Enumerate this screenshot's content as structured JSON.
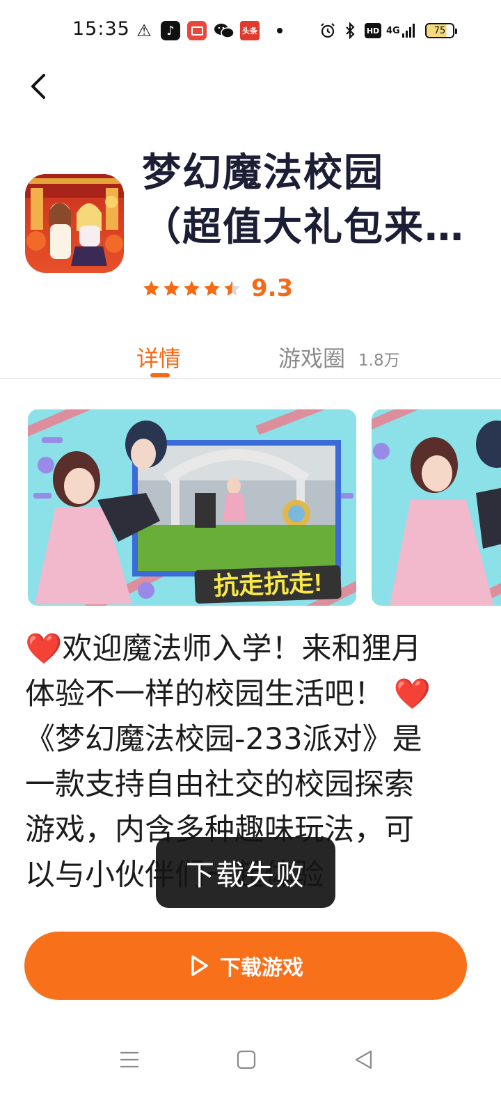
{
  "status_bar": {
    "time": "15:35",
    "battery": "75",
    "network": "4G",
    "hd_badge": "HD",
    "toutiao_badge": "头条",
    "icons": [
      "warning-icon",
      "tiktok-icon",
      "video-icon",
      "wechat-icon",
      "toutiao-icon",
      "alarm-icon",
      "bluetooth-icon",
      "hd-icon",
      "signal-icon",
      "battery-icon"
    ]
  },
  "header": {
    "back_icon": "chevron-left-icon",
    "title_line1": "梦幻魔法校园",
    "title_line2": "（超值大礼包来…",
    "rating": 4.5,
    "rating_score": "9.3"
  },
  "tabs": [
    {
      "label": "详情",
      "active": true
    },
    {
      "label": "游戏圈",
      "count": "1.8万",
      "active": false
    }
  ],
  "screenshots": {
    "caption": "抗走抗走!"
  },
  "description": {
    "heart": "❤️",
    "line1": "欢迎魔法师入学！来和狸月体验不一样的校园生活吧！",
    "line2": "《梦幻魔法校园-233派对》是一款支持自由社交的校园探索游戏，内含多种趣味玩法，可以与小伙伴们一起体验"
  },
  "toast": {
    "text": "下载失败"
  },
  "download_button": {
    "label": "下载游戏"
  },
  "colors": {
    "accent": "#f56a14",
    "button": "#f8701a",
    "title": "#1b1e34"
  }
}
